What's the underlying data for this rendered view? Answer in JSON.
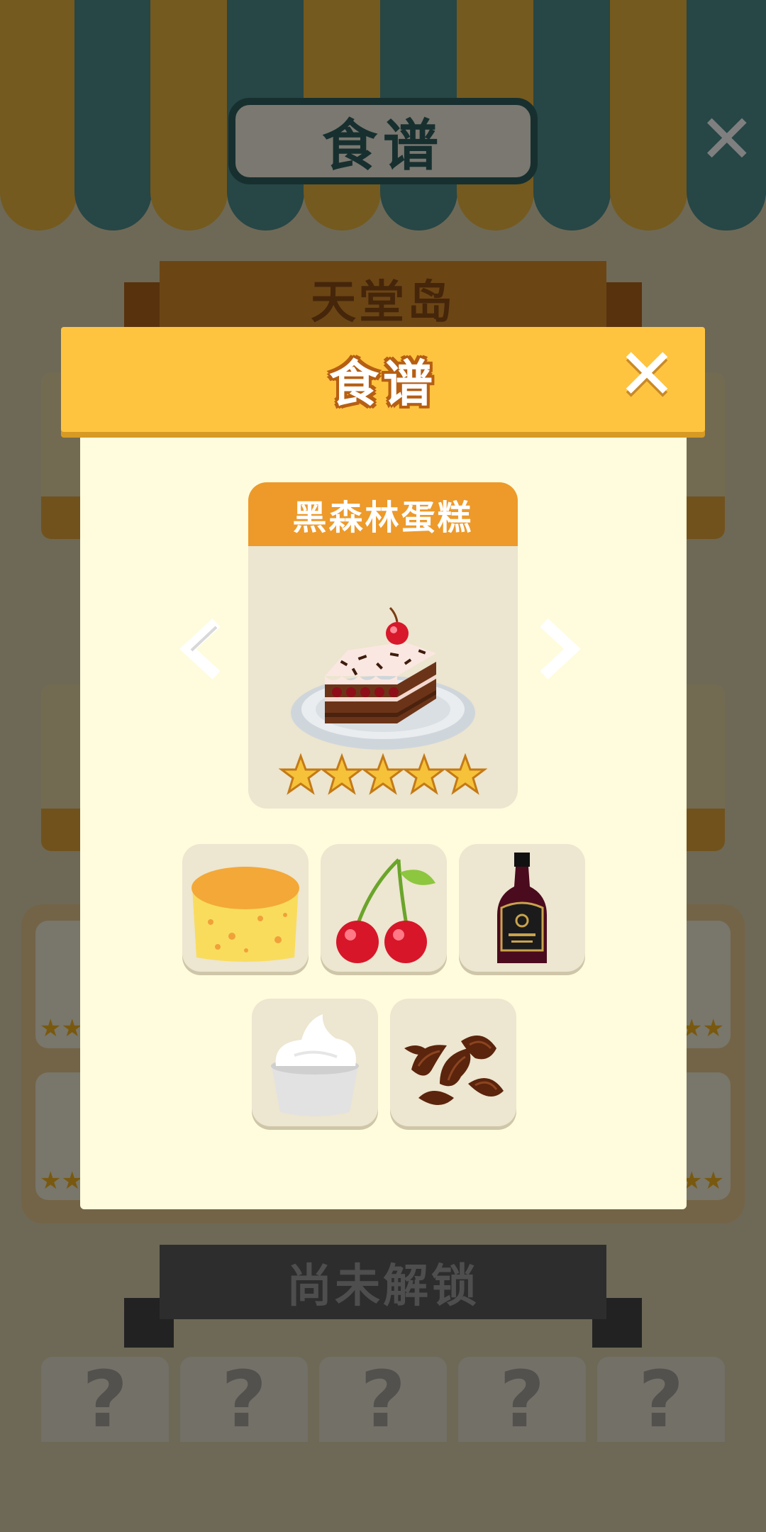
{
  "background": {
    "header_title": "食谱",
    "region_title": "天堂岛",
    "locked_title": "尚未解锁",
    "locked_slots": [
      "?",
      "?",
      "?",
      "?",
      "?"
    ]
  },
  "modal": {
    "title": "食谱",
    "close_glyph": "✕",
    "dish": {
      "name": "黑森林蛋糕",
      "icon": "black-forest-cake-icon",
      "stars_filled": 5,
      "stars_total": 5
    },
    "ingredients": [
      {
        "name": "sponge-cake",
        "icon": "sponge-cake-icon"
      },
      {
        "name": "cherries",
        "icon": "cherries-icon"
      },
      {
        "name": "cherry-liqueur",
        "icon": "liqueur-bottle-icon"
      },
      {
        "name": "whipped-cream",
        "icon": "whipped-cream-icon"
      },
      {
        "name": "chocolate-shavings",
        "icon": "chocolate-shavings-icon"
      }
    ]
  },
  "colors": {
    "header_yellow": "#fec440",
    "dish_orange": "#ed9a2a",
    "panel_cream": "#fffcdd",
    "star_gold": "#f5c23a"
  }
}
